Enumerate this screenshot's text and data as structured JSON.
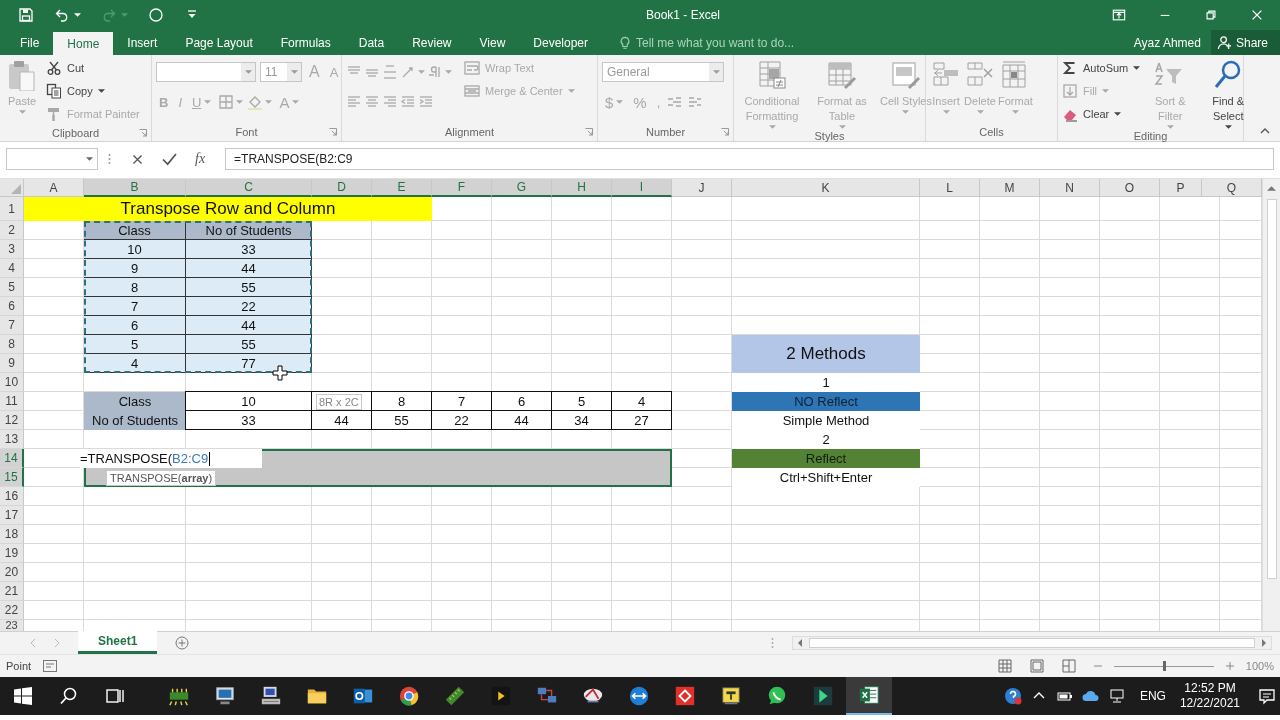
{
  "title_bar": {
    "title": "Book1 - Excel",
    "quick_access": [
      {
        "kind": "save",
        "disabled": false
      },
      {
        "kind": "undo",
        "disabled": false
      },
      {
        "kind": "redo",
        "disabled": true
      },
      {
        "kind": "touch",
        "disabled": false
      },
      {
        "kind": "customize",
        "disabled": false
      }
    ]
  },
  "tabs": [
    {
      "label": "File",
      "selected": false
    },
    {
      "label": "Home",
      "selected": true
    },
    {
      "label": "Insert",
      "selected": false
    },
    {
      "label": "Page Layout",
      "selected": false
    },
    {
      "label": "Formulas",
      "selected": false
    },
    {
      "label": "Data",
      "selected": false
    },
    {
      "label": "Review",
      "selected": false
    },
    {
      "label": "View",
      "selected": false
    },
    {
      "label": "Developer",
      "selected": false
    }
  ],
  "tell_me": {
    "placeholder": "Tell me what you want to do..."
  },
  "user": "Ayaz Ahmed",
  "share": "Share",
  "ribbon": [
    {
      "label": "Clipboard",
      "launcher": true,
      "columns": [
        [
          {
            "large": {
              "kind": "paste",
              "label": "Paste",
              "disabled": true,
              "dropdown": true
            }
          }
        ],
        [
          {
            "small": {
              "kind": "cut",
              "label": "Cut",
              "disabled": false
            }
          },
          {
            "small": {
              "kind": "copy",
              "label": "Copy",
              "disabled": false,
              "dropdown": true
            }
          },
          {
            "small": {
              "kind": "painter",
              "label": "Format Painter",
              "disabled": true
            }
          }
        ]
      ]
    },
    {
      "label": "Font",
      "launcher": true,
      "columns": [
        [
          {
            "row": [
              {
                "field": {
                  "kind": "font-name",
                  "disabled": true
                }
              },
              {
                "field": {
                  "kind": "font-size",
                  "value": "11",
                  "disabled": true
                }
              },
              {
                "glyph": {
                  "kind": "grow-font",
                  "label": "A",
                  "disabled": true
                }
              },
              {
                "glyph": {
                  "kind": "shrink-font",
                  "label": "A",
                  "disabled": true
                }
              }
            ]
          },
          {
            "row": [
              {
                "glyph": {
                  "kind": "bold",
                  "label": "B",
                  "disabled": true
                }
              },
              {
                "glyph": {
                  "kind": "italic",
                  "label": "I",
                  "disabled": true
                }
              },
              {
                "glyph": {
                  "kind": "underline",
                  "label": "U",
                  "disabled": true,
                  "dropdown": true
                }
              },
              {
                "icon": {
                  "kind": "borders",
                  "disabled": true,
                  "dropdown": true
                }
              },
              {
                "icon": {
                  "kind": "fill",
                  "disabled": true,
                  "dropdown": true
                }
              },
              {
                "glyph": {
                  "kind": "font-color",
                  "label": "A",
                  "disabled": true,
                  "dropdown": true
                }
              }
            ]
          }
        ]
      ]
    },
    {
      "label": "Alignment",
      "launcher": true,
      "columns": [
        [
          {
            "row": [
              {
                "icon": {
                  "kind": "align-top",
                  "disabled": true
                }
              },
              {
                "icon": {
                  "kind": "align-middle",
                  "disabled": true
                }
              },
              {
                "icon": {
                  "kind": "align-bottom",
                  "disabled": true
                }
              },
              {
                "icon": {
                  "kind": "orientation",
                  "disabled": true,
                  "dropdown": true
                }
              },
              {
                "icon": {
                  "kind": "direction",
                  "disabled": true,
                  "dropdown": true
                }
              }
            ]
          },
          {
            "row": [
              {
                "icon": {
                  "kind": "align-left",
                  "disabled": true
                }
              },
              {
                "icon": {
                  "kind": "align-center",
                  "disabled": true
                }
              },
              {
                "icon": {
                  "kind": "align-right",
                  "disabled": true
                }
              },
              {
                "icon": {
                  "kind": "outdent",
                  "disabled": true
                }
              },
              {
                "icon": {
                  "kind": "indent",
                  "disabled": true
                }
              }
            ]
          }
        ],
        [
          {
            "small": {
              "kind": "wrap",
              "label": "Wrap Text",
              "disabled": true
            }
          },
          {
            "small": {
              "kind": "merge",
              "label": "Merge & Center",
              "disabled": true,
              "dropdown": true
            }
          }
        ]
      ]
    },
    {
      "label": "Number",
      "launcher": true,
      "columns": [
        [
          {
            "field": {
              "kind": "number-format",
              "value": "General",
              "disabled": true
            }
          },
          {
            "row": [
              {
                "glyph": {
                  "kind": "currency",
                  "label": "$",
                  "disabled": true,
                  "dropdown": true
                }
              },
              {
                "glyph": {
                  "kind": "percent",
                  "label": "%",
                  "disabled": true
                }
              },
              {
                "glyph": {
                  "kind": "comma",
                  "label": ",",
                  "disabled": true
                }
              },
              {
                "icon": {
                  "kind": "increase-decimal",
                  "disabled": true
                }
              },
              {
                "icon": {
                  "kind": "decrease-decimal",
                  "disabled": true
                }
              }
            ]
          }
        ]
      ]
    },
    {
      "label": "Styles",
      "columns": [
        [
          {
            "large": {
              "kind": "conditional",
              "label": "Conditional Formatting",
              "disabled": true,
              "dropdown": true
            }
          }
        ],
        [
          {
            "large": {
              "kind": "table-format",
              "label": "Format as Table",
              "disabled": true,
              "dropdown": true
            }
          }
        ],
        [
          {
            "large": {
              "kind": "cell-styles",
              "label": "Cell Styles",
              "disabled": true,
              "dropdown": true
            }
          }
        ]
      ]
    },
    {
      "label": "Cells",
      "columns": [
        [
          {
            "large": {
              "kind": "insert",
              "label": "Insert",
              "disabled": true,
              "dropdown": true
            }
          }
        ],
        [
          {
            "large": {
              "kind": "delete",
              "label": "Delete",
              "disabled": true,
              "dropdown": true
            }
          }
        ],
        [
          {
            "large": {
              "kind": "format",
              "label": "Format",
              "disabled": true,
              "dropdown": true
            }
          }
        ]
      ]
    },
    {
      "label": "Editing",
      "columns": [
        [
          {
            "small": {
              "kind": "autosum",
              "label": "AutoSum",
              "disabled": false,
              "dropdown": true
            }
          },
          {
            "small": {
              "kind": "fill-down",
              "label": "Fill",
              "disabled": true,
              "dropdown": true
            }
          },
          {
            "small": {
              "kind": "clear",
              "label": "Clear",
              "disabled": false,
              "dropdown": true
            }
          }
        ],
        [
          {
            "large": {
              "kind": "sort",
              "label": "Sort & Filter",
              "disabled": true,
              "dropdown": true
            }
          }
        ],
        [
          {
            "large": {
              "kind": "find",
              "label": "Find & Select",
              "disabled": false,
              "dropdown": true
            }
          }
        ]
      ]
    }
  ],
  "formula_bar": {
    "function_label": "fx",
    "formula": "=TRANSPOSE(B2:C9"
  },
  "columns": [
    {
      "label": "A",
      "selected": false
    },
    {
      "label": "B",
      "selected": true
    },
    {
      "label": "C",
      "selected": true
    },
    {
      "label": "D",
      "selected": true
    },
    {
      "label": "E",
      "selected": true
    },
    {
      "label": "F",
      "selected": true
    },
    {
      "label": "G",
      "selected": true
    },
    {
      "label": "H",
      "selected": true
    },
    {
      "label": "I",
      "selected": true
    },
    {
      "label": "J",
      "selected": false
    },
    {
      "label": "K",
      "selected": false
    },
    {
      "label": "L",
      "selected": false
    },
    {
      "label": "M",
      "selected": false
    },
    {
      "label": "N",
      "selected": false
    },
    {
      "label": "O",
      "selected": false
    },
    {
      "label": "P",
      "selected": false
    },
    {
      "label": "Q",
      "selected": false
    }
  ],
  "rows": [
    {
      "label": "1",
      "selected": false,
      "cells": {
        "A": {
          "text": "Transpose Row and Column",
          "kind": "title"
        }
      }
    },
    {
      "label": "2",
      "selected": false,
      "cells": {
        "B": {
          "text": "Class",
          "kind": "header"
        },
        "C": {
          "text": "No of Students",
          "kind": "header"
        }
      }
    },
    {
      "label": "3",
      "selected": false,
      "cells": {
        "B": {
          "text": "10",
          "kind": "data"
        },
        "C": {
          "text": "33",
          "kind": "data"
        }
      }
    },
    {
      "label": "4",
      "selected": false,
      "cells": {
        "B": {
          "text": "9",
          "kind": "data"
        },
        "C": {
          "text": "44",
          "kind": "data"
        }
      }
    },
    {
      "label": "5",
      "selected": false,
      "cells": {
        "B": {
          "text": "8",
          "kind": "data"
        },
        "C": {
          "text": "55",
          "kind": "data"
        }
      }
    },
    {
      "label": "6",
      "selected": false,
      "cells": {
        "B": {
          "text": "7",
          "kind": "data"
        },
        "C": {
          "text": "22",
          "kind": "data"
        }
      }
    },
    {
      "label": "7",
      "selected": false,
      "cells": {
        "B": {
          "text": "6",
          "kind": "data"
        },
        "C": {
          "text": "44",
          "kind": "data"
        }
      }
    },
    {
      "label": "8",
      "selected": false,
      "cells": {
        "B": {
          "text": "5",
          "kind": "data"
        },
        "C": {
          "text": "55",
          "kind": "data"
        },
        "K": {
          "text": "2 Methods",
          "kind": "methods"
        }
      }
    },
    {
      "label": "9",
      "selected": false,
      "cells": {
        "B": {
          "text": "4",
          "kind": "data"
        },
        "C": {
          "text": "77",
          "kind": "data",
          "pointer": true
        }
      }
    },
    {
      "label": "10",
      "selected": false,
      "cells": {
        "K": {
          "text": "1",
          "kind": "plain"
        }
      }
    },
    {
      "label": "11",
      "selected": false,
      "cells": {
        "B": {
          "text": "Class",
          "kind": "label"
        },
        "C": {
          "text": "10",
          "kind": "boxed"
        },
        "D": {
          "kind": "boxed",
          "tip": "8R x 2C"
        },
        "E": {
          "text": "8",
          "kind": "boxed"
        },
        "F": {
          "text": "7",
          "kind": "boxed"
        },
        "G": {
          "text": "6",
          "kind": "boxed"
        },
        "H": {
          "text": "5",
          "kind": "boxed"
        },
        "I": {
          "text": "4",
          "kind": "boxed"
        },
        "K": {
          "text": "NO Reflect",
          "kind": "blue"
        }
      }
    },
    {
      "label": "12",
      "selected": false,
      "cells": {
        "B": {
          "text": "No of Students",
          "kind": "label"
        },
        "C": {
          "text": "33",
          "kind": "boxed"
        },
        "D": {
          "text": "44",
          "kind": "boxed"
        },
        "E": {
          "text": "55",
          "kind": "boxed"
        },
        "F": {
          "text": "22",
          "kind": "boxed"
        },
        "G": {
          "text": "44",
          "kind": "boxed"
        },
        "H": {
          "text": "34",
          "kind": "boxed"
        },
        "I": {
          "text": "27",
          "kind": "boxed"
        },
        "K": {
          "text": "Simple Method",
          "kind": "plain"
        }
      }
    },
    {
      "label": "13",
      "selected": false,
      "cells": {
        "K": {
          "text": "2",
          "kind": "plain"
        }
      }
    },
    {
      "label": "14",
      "selected": true,
      "cells": {
        "B": {
          "kind": "editor",
          "text": "=TRANSPOSE(",
          "reference": "B2:C9",
          "tooltip": "TRANSPOSE(**array**)"
        },
        "K": {
          "text": "Reflect",
          "kind": "green"
        }
      }
    },
    {
      "label": "15",
      "selected": true,
      "cells": {
        "K": {
          "text": "Ctrl+Shift+Enter",
          "kind": "plain"
        }
      }
    },
    {
      "label": "16",
      "selected": false
    },
    {
      "label": "17",
      "selected": false
    },
    {
      "label": "18",
      "selected": false
    },
    {
      "label": "19",
      "selected": false
    },
    {
      "label": "20",
      "selected": false
    },
    {
      "label": "21",
      "selected": false
    },
    {
      "label": "22",
      "selected": false
    },
    {
      "label": "23",
      "selected": false
    }
  ],
  "copy_marquee": true,
  "sheets": [
    {
      "label": "Sheet1",
      "selected": true
    }
  ],
  "status_bar": {
    "mode": "Point",
    "zoom": "100%",
    "zoom_slider": {
      "level": 0.5
    }
  },
  "taskbar": {
    "apps": [
      {
        "kind": "network",
        "active": false
      },
      {
        "kind": "computer",
        "active": false
      },
      {
        "kind": "terminal",
        "active": false
      },
      {
        "kind": "folder",
        "active": false
      },
      {
        "kind": "mail",
        "active": false
      },
      {
        "kind": "browser",
        "active": false
      },
      {
        "kind": "ruler",
        "active": false
      },
      {
        "kind": "player",
        "active": false
      },
      {
        "kind": "lan",
        "active": false
      },
      {
        "kind": "disc",
        "active": false
      },
      {
        "kind": "remote",
        "active": false
      },
      {
        "kind": "desk",
        "active": false
      },
      {
        "kind": "notes",
        "active": false
      },
      {
        "kind": "chat",
        "active": false
      },
      {
        "kind": "arrow",
        "active": false
      },
      {
        "kind": "spreadsheet",
        "active": true
      }
    ],
    "language": "ENG",
    "time": "12:52 PM",
    "date": "12/22/2021"
  }
}
